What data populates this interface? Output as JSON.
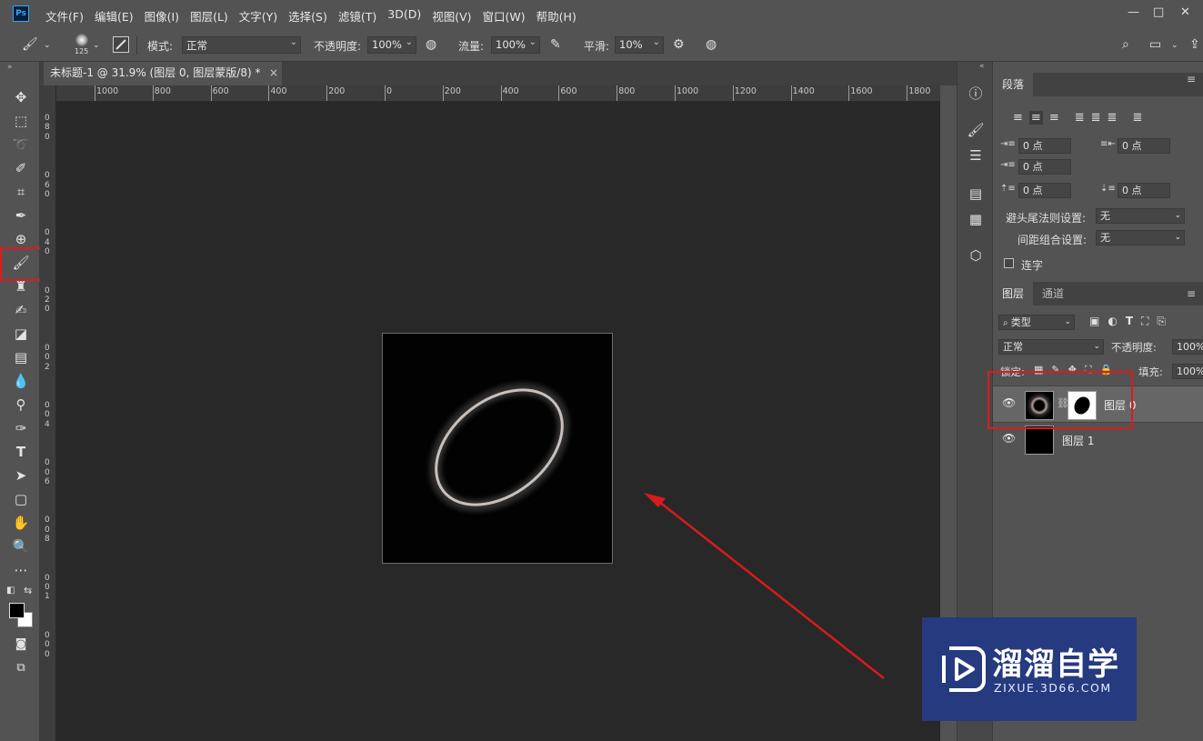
{
  "app": {
    "logo": "Ps"
  },
  "menu": [
    "文件(F)",
    "编辑(E)",
    "图像(I)",
    "图层(L)",
    "文字(Y)",
    "选择(S)",
    "滤镜(T)",
    "3D(D)",
    "视图(V)",
    "窗口(W)",
    "帮助(H)"
  ],
  "window_controls": {
    "minimize": "—",
    "restore": "□",
    "close": "✕"
  },
  "options": {
    "brush_size": "125",
    "mode_label": "模式:",
    "mode_value": "正常",
    "opacity_label": "不透明度:",
    "opacity_value": "100%",
    "flow_label": "流量:",
    "flow_value": "100%",
    "smoothing_label": "平滑:",
    "smoothing_value": "10%"
  },
  "document_tab": {
    "title": "未标题-1 @ 31.9% (图层 0, 图层蒙版/8) *",
    "close": "×"
  },
  "ruler": {
    "h_labels": [
      "1000",
      "800",
      "600",
      "400",
      "200",
      "0",
      "200",
      "400",
      "600",
      "800",
      "1000",
      "1200",
      "1400",
      "1600",
      "1800"
    ],
    "v_labels": [
      "0",
      "8",
      "0",
      "0",
      "6",
      "0",
      "0",
      "4",
      "0",
      "0",
      "2",
      "0",
      "0",
      "0",
      "2",
      "0",
      "0",
      "4",
      "0",
      "0",
      "6",
      "0",
      "0",
      "8",
      "0",
      "0",
      "1",
      "0",
      "0",
      "0"
    ]
  },
  "paragraph_panel": {
    "tab": "段落",
    "indent_left": "0 点",
    "indent_right": "0 点",
    "indent_first": "0 点",
    "space_before": "0 点",
    "space_after": "0 点",
    "kinsoku_label": "避头尾法则设置:",
    "kinsoku_value": "无",
    "mojikumi_label": "间距组合设置:",
    "mojikumi_value": "无",
    "hyphenate_label": "连字"
  },
  "layers_panel": {
    "tabs": [
      "图层",
      "通道"
    ],
    "filter_label": "类型",
    "blend_mode": "正常",
    "opacity_label": "不透明度:",
    "opacity_value": "100%",
    "lock_label": "锁定:",
    "fill_label": "填充:",
    "fill_value": "100%",
    "layers": [
      {
        "name": "图层 0"
      },
      {
        "name": "图层 1"
      }
    ]
  },
  "watermark": {
    "text": "溜溜自学",
    "url": "ZIXUE.3D66.COM"
  },
  "colors": {
    "highlight": "#e0191b",
    "watermark_bg": "#253a7f",
    "canvas_bg": "#282828",
    "ui_bg": "#535353"
  }
}
